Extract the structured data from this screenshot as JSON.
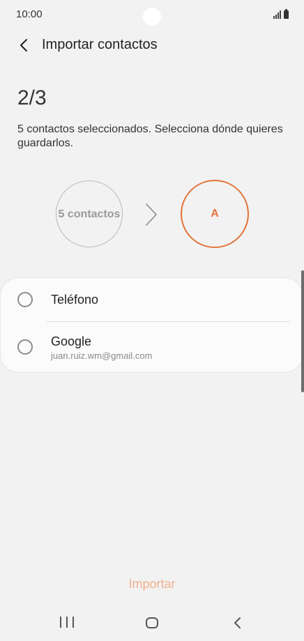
{
  "status_bar": {
    "time": "10:00",
    "signal_icon": "signal-icon",
    "battery_icon": "battery-icon"
  },
  "header": {
    "back_icon": "back-arrow-icon",
    "title": "Importar contactos"
  },
  "step": {
    "counter": "2/3",
    "description": "5 contactos seleccionados. Selecciona dónde quieres guardarlos."
  },
  "flow": {
    "source_label": "5 contactos",
    "target_label": "A",
    "accent_color": "#e3743a"
  },
  "options": [
    {
      "label": "Teléfono",
      "sublabel": ""
    },
    {
      "label": "Google",
      "sublabel": "juan.ruiz.wm@gmail.com"
    }
  ],
  "actions": {
    "import_label": "Importar",
    "import_color": "#f0b08f"
  },
  "nav_bar": {
    "recent_icon": "recent-apps-icon",
    "home_icon": "home-icon",
    "back_icon": "nav-back-icon"
  }
}
